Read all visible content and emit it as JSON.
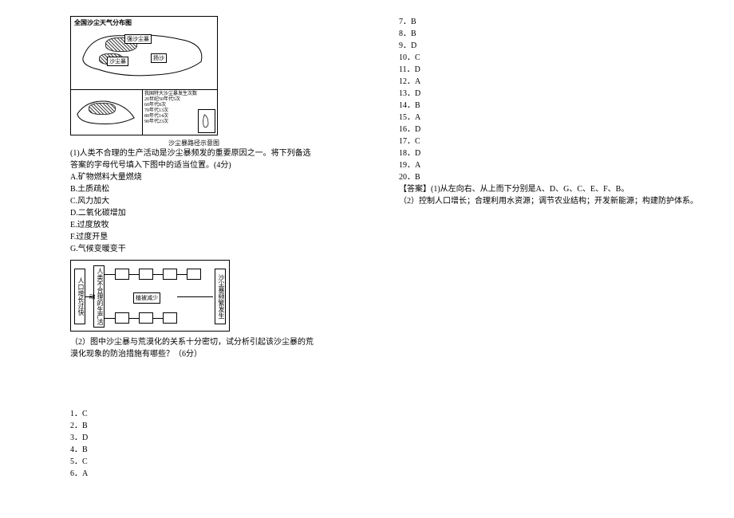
{
  "map": {
    "title": "全国沙尘天气分布图",
    "label1": "强沙尘暴",
    "label2": "沙尘暴",
    "label3": "扬沙",
    "caption": "沙尘暴路径示意图",
    "legendTitle": "我国特大沙尘暴发生次数",
    "legend": [
      "20世纪50年代5次",
      "60年代8次",
      "70年代13次",
      "80年代14次",
      "90年代23次"
    ]
  },
  "q1": {
    "text": "(1)人类不合理的生产活动是沙尘暴频发的重要原因之一。将下列备选答案的字母代号填入下图中的适当位置。(4分)",
    "choices": {
      "A": "A.矿物燃料大量燃烧",
      "B": "B.土质疏松",
      "C": "C.风力加大",
      "D": "D.二氧化碳增加",
      "E": "E.过度放牧",
      "F": "F.过度开垦",
      "G": "G.气候变暖变干"
    }
  },
  "diagram": {
    "left1": "人口增长过快",
    "left2": "人类不合理的生产活动",
    "mid": "植被减少",
    "right": "沙尘暴频繁发生"
  },
  "q2": {
    "text": "（2）图中沙尘暴与荒漠化的关系十分密切，试分析引起该沙尘暴的荒漠化现象的防治措施有哪些？（6分）"
  },
  "answers": [
    "1．C",
    "2．B",
    "3．D",
    "4．B",
    "5．C",
    "6．A",
    "7．B",
    "8．B",
    "9．D",
    "10．C",
    "11．D",
    "12．A",
    "13．D",
    "14．B",
    "15．A",
    "16．D",
    "17．C",
    "18．D",
    "19．A",
    "20．B"
  ],
  "finalAnswer": {
    "label": "【答案】",
    "part1": "(1)从左向右、从上而下分别是A、D、G、C、E、F、B。",
    "part2": "（2）控制人口增长；合理利用水资源；调节农业结构；开发新能源；构建防护体系。"
  }
}
